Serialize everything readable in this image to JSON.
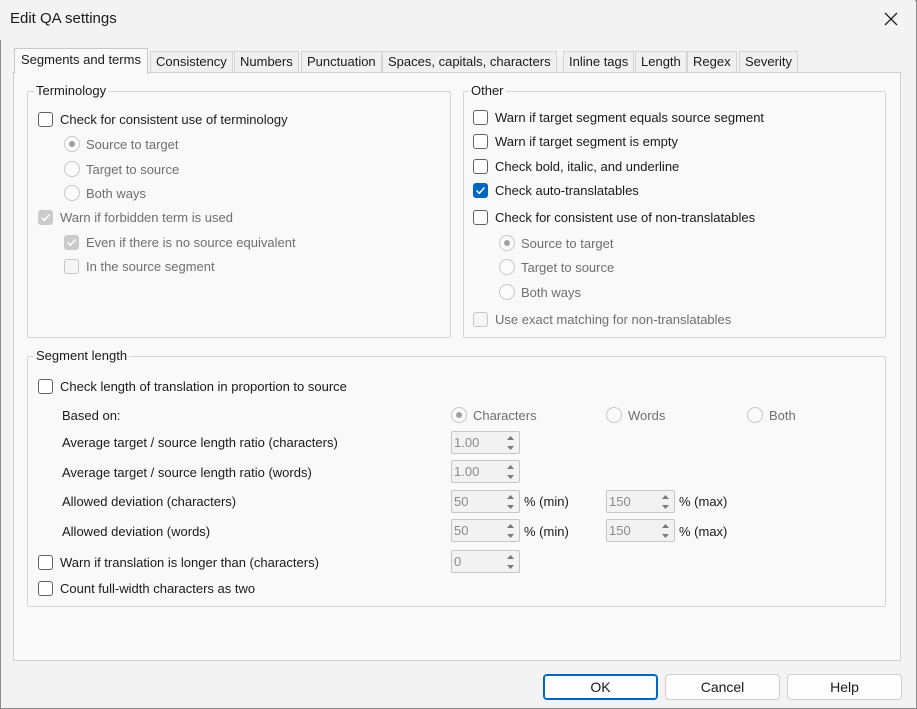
{
  "window": {
    "title": "Edit QA settings"
  },
  "tabs": [
    {
      "label": "Segments and terms",
      "active": true
    },
    {
      "label": "Consistency"
    },
    {
      "label": "Numbers"
    },
    {
      "label": "Punctuation"
    },
    {
      "label": "Spaces, capitals, characters"
    },
    {
      "label": "Inline tags"
    },
    {
      "label": "Length"
    },
    {
      "label": "Regex"
    },
    {
      "label": "Severity"
    }
  ],
  "terminology": {
    "title": "Terminology",
    "check_consistent": "Check for consistent use of terminology",
    "radio_source_to_target": "Source to target",
    "radio_target_to_source": "Target to source",
    "radio_both_ways": "Both ways",
    "warn_forbidden": "Warn if forbidden term is used",
    "even_if_no_source": "Even if there is no source equivalent",
    "in_source_segment": "In the source segment"
  },
  "other": {
    "title": "Other",
    "warn_equals": "Warn if target segment equals source segment",
    "warn_empty": "Warn if target segment is empty",
    "check_bold": "Check bold, italic, and underline",
    "check_auto": "Check auto-translatables",
    "check_nontrans": "Check for consistent use of non-translatables",
    "radio_source_to_target": "Source to target",
    "radio_target_to_source": "Target to source",
    "radio_both_ways": "Both ways",
    "exact_matching": "Use exact matching for non-translatables"
  },
  "segment_length": {
    "title": "Segment length",
    "check_length": "Check length of translation in proportion to source",
    "based_on": "Based on:",
    "opt_characters": "Characters",
    "opt_words": "Words",
    "opt_both": "Both",
    "avg_chars_label": "Average target / source length ratio (characters)",
    "avg_chars_value": "1.00",
    "avg_words_label": "Average target / source length ratio (words)",
    "avg_words_value": "1.00",
    "dev_chars_label": "Allowed deviation (characters)",
    "dev_chars_min": "50",
    "dev_chars_max": "150",
    "dev_words_label": "Allowed deviation (words)",
    "dev_words_min": "50",
    "dev_words_max": "150",
    "pct_min": "% (min)",
    "pct_max": "% (max)",
    "warn_longer_label": "Warn if translation is longer than (characters)",
    "warn_longer_value": "0",
    "count_fullwidth": "Count full-width characters as two"
  },
  "buttons": {
    "ok": "OK",
    "cancel": "Cancel",
    "help": "Help"
  },
  "colors": {
    "accent": "#0067c0",
    "disabled_text": "#6f6f6f"
  }
}
